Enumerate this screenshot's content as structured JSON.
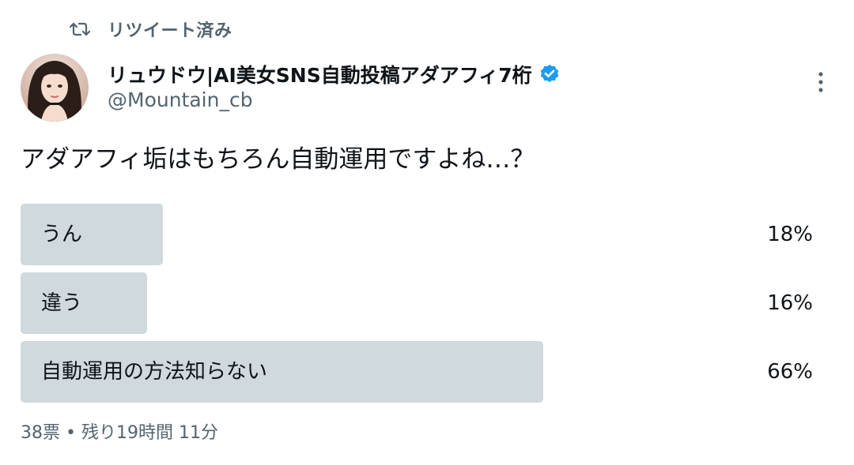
{
  "retweet": {
    "icon": "retweet-icon",
    "label": "リツイート済み"
  },
  "author": {
    "avatar_icon": "avatar",
    "name": "リュウドウ|AI美女SNS自動投稿アダアフィ7桁",
    "verified_icon": "verified-badge-icon",
    "handle": "@Mountain_cb"
  },
  "more_icon": "more-vertical-icon",
  "tweet": {
    "text": "アダアフィ垢はもちろん自動運用ですよね…？"
  },
  "poll": {
    "bar_color": "#cfd9de",
    "options": [
      {
        "label": "うん",
        "percent": "18%",
        "fraction": 0.18
      },
      {
        "label": "違う",
        "percent": "16%",
        "fraction": 0.16
      },
      {
        "label": "自動運用の方法知らない",
        "percent": "66%",
        "fraction": 0.66
      }
    ],
    "meta": "38票 • 残り19時間 11分"
  },
  "colors": {
    "text_primary": "#0f1419",
    "text_secondary": "#536471",
    "verified_blue": "#1d9bf0"
  }
}
